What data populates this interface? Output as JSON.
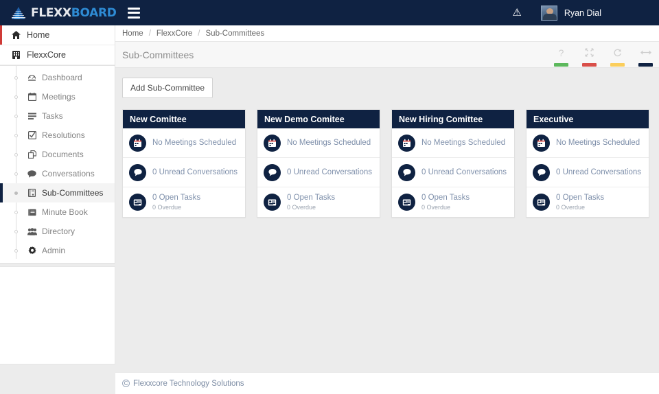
{
  "topbar": {
    "brand_primary": "FLEXX",
    "brand_secondary": "BOARD",
    "menu_icon": "hamburger-icon",
    "warning_icon": "warning-triangle-icon",
    "user_name": "Ryan Dial"
  },
  "sidebar": {
    "primary": [
      {
        "label": "Home",
        "icon": "home-icon"
      },
      {
        "label": "FlexxCore",
        "icon": "building-icon"
      }
    ],
    "sub_items": [
      {
        "label": "Dashboard",
        "icon": "dashboard-icon"
      },
      {
        "label": "Meetings",
        "icon": "calendar-icon"
      },
      {
        "label": "Tasks",
        "icon": "list-icon"
      },
      {
        "label": "Resolutions",
        "icon": "check-square-icon"
      },
      {
        "label": "Documents",
        "icon": "documents-icon"
      },
      {
        "label": "Conversations",
        "icon": "chat-icon"
      },
      {
        "label": "Sub-Committees",
        "icon": "book-icon"
      },
      {
        "label": "Minute Book",
        "icon": "notebook-icon"
      },
      {
        "label": "Directory",
        "icon": "people-icon"
      },
      {
        "label": "Admin",
        "icon": "gear-icon"
      }
    ],
    "active_item": "Sub-Committees"
  },
  "breadcrumb": {
    "items": [
      "Home",
      "FlexxCore",
      "Sub-Committees"
    ],
    "separator": "/"
  },
  "page": {
    "title": "Sub-Committees",
    "widget_icons": [
      {
        "name": "help-icon",
        "glyph": "?",
        "bar_color": "#5cb85c"
      },
      {
        "name": "collapse-icon",
        "glyph": "collapse",
        "bar_color": "#d94f49"
      },
      {
        "name": "refresh-icon",
        "glyph": "refresh",
        "bar_color": "#fbce5c"
      },
      {
        "name": "resize-icon",
        "glyph": "resize",
        "bar_color": "#0f2242"
      }
    ],
    "add_button": "Add Sub-Committee"
  },
  "cards": [
    {
      "title": "New Comittee",
      "rows": [
        {
          "icon": "calendar-icon",
          "main": "No Meetings Scheduled",
          "sub": ""
        },
        {
          "icon": "chat-icon",
          "main": "0 Unread Conversations",
          "sub": ""
        },
        {
          "icon": "tasks-icon",
          "main": "0 Open Tasks",
          "sub": "0 Overdue"
        }
      ]
    },
    {
      "title": "New Demo Comitee",
      "rows": [
        {
          "icon": "calendar-icon",
          "main": "No Meetings Scheduled",
          "sub": ""
        },
        {
          "icon": "chat-icon",
          "main": "0 Unread Conversations",
          "sub": ""
        },
        {
          "icon": "tasks-icon",
          "main": "0 Open Tasks",
          "sub": "0 Overdue"
        }
      ]
    },
    {
      "title": "New Hiring Comittee",
      "rows": [
        {
          "icon": "calendar-icon",
          "main": "No Meetings Scheduled",
          "sub": ""
        },
        {
          "icon": "chat-icon",
          "main": "0 Unread Conversations",
          "sub": ""
        },
        {
          "icon": "tasks-icon",
          "main": "0 Open Tasks",
          "sub": "0 Overdue"
        }
      ]
    },
    {
      "title": "Executive",
      "rows": [
        {
          "icon": "calendar-icon",
          "main": "No Meetings Scheduled",
          "sub": ""
        },
        {
          "icon": "chat-icon",
          "main": "0 Unread Conversations",
          "sub": ""
        },
        {
          "icon": "tasks-icon",
          "main": "0 Open Tasks",
          "sub": "0 Overdue"
        }
      ]
    }
  ],
  "footer": {
    "copyright_mark": "C",
    "text": "Flexxcore Technology Solutions"
  },
  "colors": {
    "navy": "#0f2242",
    "accent_blue": "#2e8bd4",
    "accent_red": "#cf3a36",
    "text_blue_gray": "#7f90ab"
  }
}
